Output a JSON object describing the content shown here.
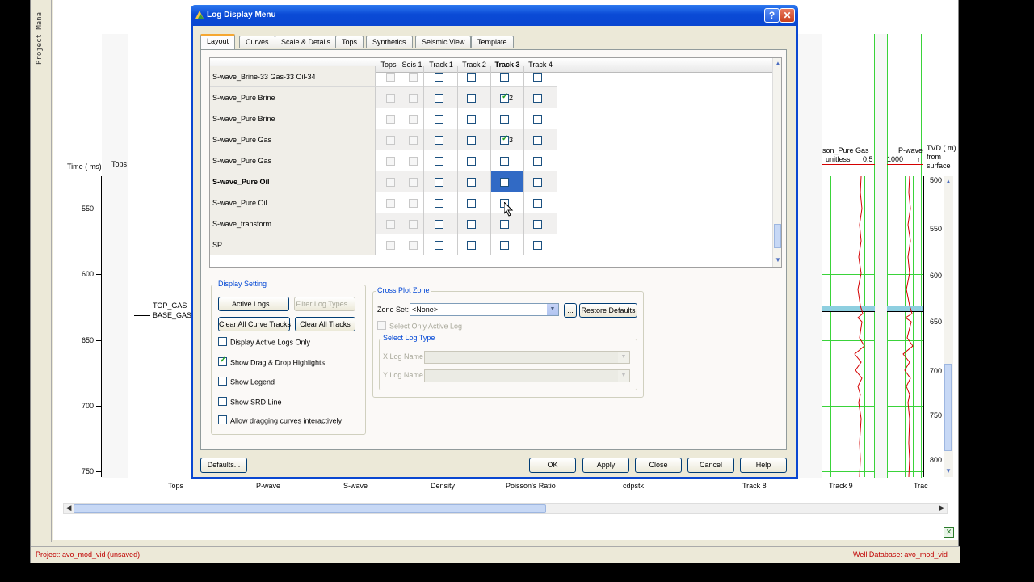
{
  "background": {
    "project_label": "Project Mana",
    "time_header": "Time ( ms)",
    "tops_header": "Tops",
    "time_ticks": [
      "550",
      "600",
      "650",
      "700",
      "750"
    ],
    "tops_markers": [
      "TOP_GAS",
      "BASE_GAS"
    ],
    "right_track1_header": "son_Pure Gas",
    "right_track1_unit": "unitless",
    "right_track1_max": "0.5",
    "right_track2_header": "P-wave",
    "right_track2_min": "1000",
    "right_track2_max": "r",
    "tvd_header": "TVD ( m)",
    "tvd_sub1": "from",
    "tvd_sub2": "surface",
    "tvd_ticks": [
      "500",
      "550",
      "600",
      "650",
      "700",
      "750",
      "800"
    ],
    "bottom_tracks": [
      "Tops",
      "P-wave",
      "S-wave",
      "Density",
      "Poisson's Ratio",
      "cdpstk",
      "Track 8",
      "Track 9",
      "Trac"
    ],
    "status_project": "Project: avo_mod_vid (unsaved)",
    "status_well_db": "Well Database: avo_mod_vid",
    "colors": {
      "grid_green": "#3ad33a",
      "curve_red": "#d40000",
      "status_red": "#c00000"
    }
  },
  "dialog": {
    "title": "Log Display Menu",
    "help_btn": "?",
    "close_btn": "✕",
    "tabs": [
      "Layout",
      "Curves",
      "Scale & Details",
      "Tops",
      "Synthetics",
      "Seismic View",
      "Template"
    ],
    "active_tab": "Layout",
    "grid": {
      "columns": [
        "Tops",
        "Seis 1",
        "Track 1",
        "Track 2",
        "Track 3",
        "Track 4"
      ],
      "bold_column": "Track 3",
      "rows": [
        {
          "name": "S-wave_Brine-33 Gas-33 Oil-34",
          "track3": ""
        },
        {
          "name": "S-wave_Pure Brine",
          "track3": "2"
        },
        {
          "name": "S-wave_Pure Brine",
          "track3": ""
        },
        {
          "name": "S-wave_Pure Gas",
          "track3": "3"
        },
        {
          "name": "S-wave_Pure Gas",
          "track3": ""
        },
        {
          "name": "S-wave_Pure Oil",
          "track3": ""
        },
        {
          "name": "S-wave_Pure Oil",
          "track3": ""
        },
        {
          "name": "S-wave_transform",
          "track3": ""
        },
        {
          "name": "SP",
          "track3": ""
        }
      ]
    },
    "display_setting": {
      "label": "Display Setting",
      "active_logs_btn": "Active Logs...",
      "filter_log_types_btn": "Filter Log Types...",
      "clear_all_curve_btn": "Clear All Curve Tracks",
      "clear_all_tracks_btn": "Clear All Tracks",
      "opt_display_active": "Display Active Logs Only",
      "opt_drag_drop": "Show Drag & Drop Highlights",
      "opt_legend": "Show Legend",
      "opt_srd": "Show SRD Line",
      "opt_allow_drag": "Allow dragging curves interactively"
    },
    "cross_plot": {
      "label": "Cross Plot Zone",
      "zone_set_label": "Zone Set:",
      "zone_set_value": "<None>",
      "ellipsis_btn": "...",
      "restore_btn": "Restore Defaults",
      "select_only_active": "Select Only Active Log",
      "select_log_type": "Select Log Type",
      "x_log_name": "X Log Name",
      "y_log_name": "Y Log Name"
    },
    "footer": {
      "defaults_btn": "Defaults...",
      "ok_btn": "OK",
      "apply_btn": "Apply",
      "close_btn": "Close",
      "cancel_btn": "Cancel",
      "help_btn": "Help"
    }
  }
}
